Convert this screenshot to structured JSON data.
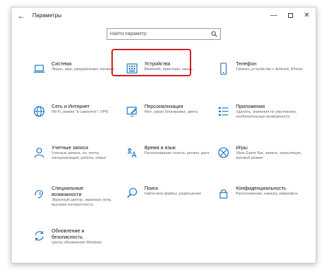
{
  "window": {
    "title": "Параметры",
    "back_glyph": "←",
    "minimize_glyph": "—",
    "close_glyph": "✕"
  },
  "search": {
    "placeholder": "Найти параметр",
    "value": ""
  },
  "accent_color": "#0067c0",
  "highlight_color": "#d21a1a",
  "tiles": [
    {
      "title": "Система",
      "desc": "Экран, звук, уведомления, питание",
      "icon": "laptop-icon"
    },
    {
      "title": "Устройства",
      "desc": "Bluetooth, принтеры, мышь",
      "icon": "keyboard-icon"
    },
    {
      "title": "Телефон",
      "desc": "Связать устройство с Android, iPhone",
      "icon": "phone-icon"
    },
    {
      "title": "Сеть и Интернет",
      "desc": "Wi-Fi, режим \"в самолете\", VPN",
      "icon": "globe-icon"
    },
    {
      "title": "Персонализация",
      "desc": "Фон, экран блокировки, цвета",
      "icon": "brush-icon"
    },
    {
      "title": "Приложения",
      "desc": "Удалить, значения по умолчанию, необязательные возможности",
      "icon": "apps-list-icon"
    },
    {
      "title": "Учетные записи",
      "desc": "Учетные записи, эл. почта, синхронизация, работа, семья",
      "icon": "person-icon"
    },
    {
      "title": "Время и язык",
      "desc": "Распознавание голоса, регион, дата",
      "icon": "time-language-icon"
    },
    {
      "title": "Игры",
      "desc": "Xbox Game Bar, записи, трансляция, игровой режим",
      "icon": "xbox-icon"
    },
    {
      "title": "Специальные возможности",
      "desc": "Экранный диктор, экранная лупа, высокая контрастность",
      "icon": "accessibility-icon"
    },
    {
      "title": "Поиск",
      "desc": "Найти мои файлы, разрешения",
      "icon": "search-icon"
    },
    {
      "title": "Конфиденциальность",
      "desc": "Расположение, камера, микрофон",
      "icon": "lock-icon"
    },
    {
      "title": "Обновление и безопасность",
      "desc": "Центр обновления Windows",
      "icon": "sync-icon"
    }
  ]
}
